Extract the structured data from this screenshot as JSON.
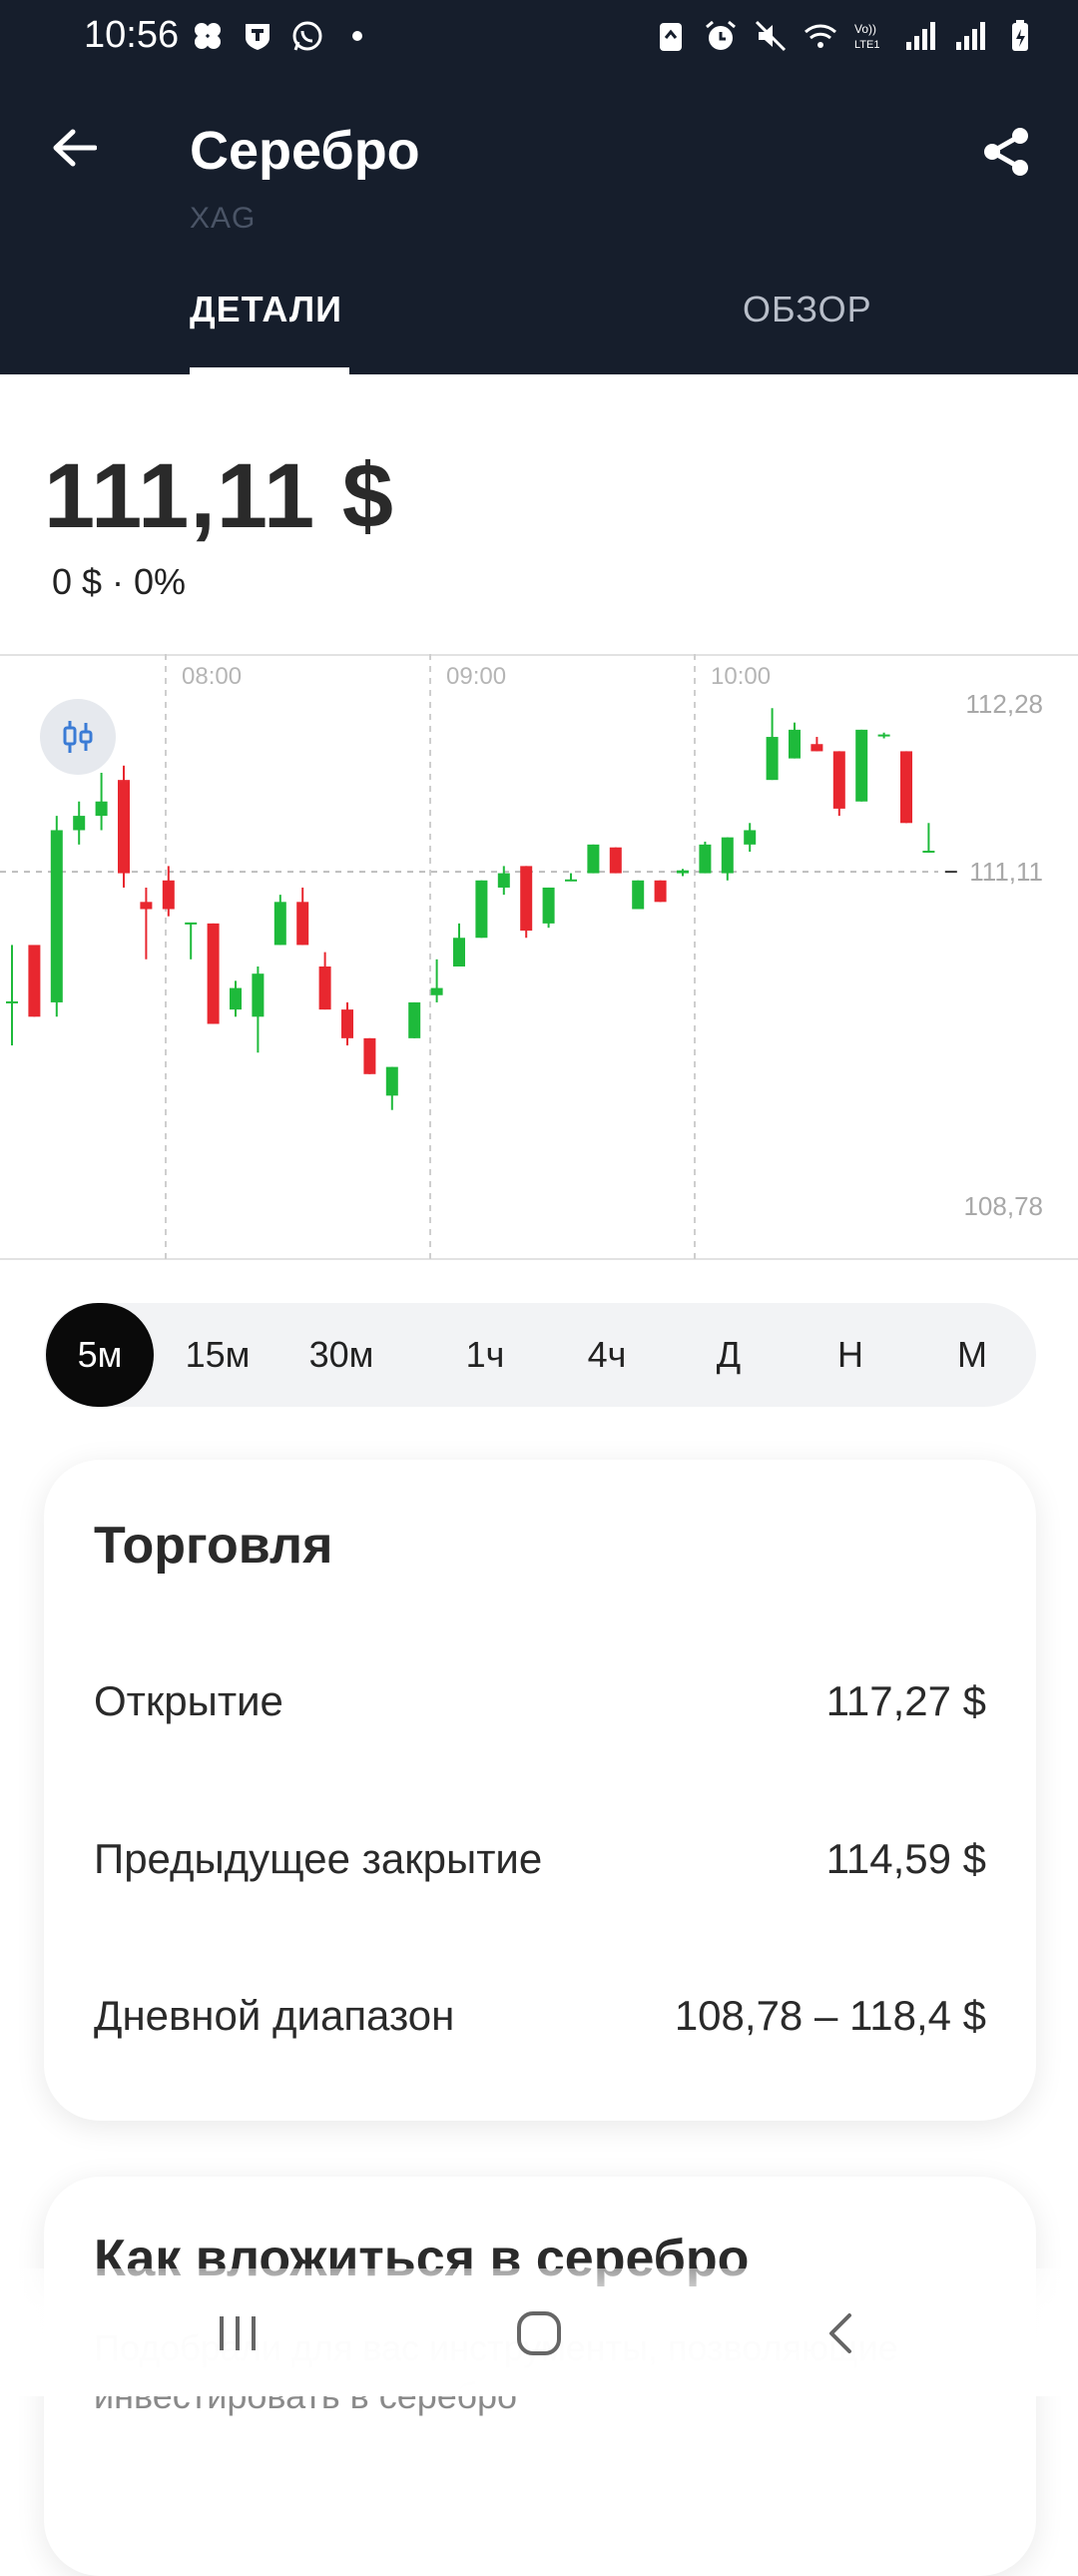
{
  "status_bar": {
    "time": "10:56",
    "icons": [
      "apps-icon",
      "shield-icon",
      "whatsapp-icon",
      "dot-icon",
      "recycle-icon",
      "alarm-icon",
      "mute-icon",
      "wifi-icon",
      "volte-icon",
      "signal-icon",
      "signal-icon",
      "battery-icon"
    ]
  },
  "header": {
    "title": "Серебро",
    "ticker": "XAG",
    "back_icon": "arrow-left-icon",
    "share_icon": "share-icon"
  },
  "tabs": [
    {
      "label": "ДЕТАЛИ",
      "active": true
    },
    {
      "label": "ОБЗОР",
      "active": false
    }
  ],
  "price": {
    "value": "111,11 $",
    "change": "0 $ · 0%"
  },
  "chart_data": {
    "type": "candlestick",
    "time_labels": [
      "08:00",
      "09:00",
      "10:00"
    ],
    "y_labels": [
      "112,28",
      "111,11",
      "108,78"
    ],
    "ylim": [
      108.78,
      112.28
    ],
    "current_value": 111.11,
    "colors": {
      "up": "#1eba3b",
      "down": "#e8272f",
      "grid": "#cfcfcf"
    },
    "candles": [
      {
        "o": 110.2,
        "c": 110.2,
        "h": 110.6,
        "l": 109.9
      },
      {
        "o": 110.6,
        "c": 110.1,
        "h": 110.2,
        "l": 110.4
      },
      {
        "o": 110.2,
        "c": 111.4,
        "h": 111.5,
        "l": 110.1
      },
      {
        "o": 111.4,
        "c": 111.5,
        "h": 111.6,
        "l": 111.3
      },
      {
        "o": 111.5,
        "c": 111.6,
        "h": 111.8,
        "l": 111.4
      },
      {
        "o": 111.75,
        "c": 111.1,
        "h": 111.85,
        "l": 111.0
      },
      {
        "o": 110.9,
        "c": 110.85,
        "h": 111.0,
        "l": 110.5
      },
      {
        "o": 111.05,
        "c": 110.85,
        "h": 111.15,
        "l": 110.8
      },
      {
        "o": 110.75,
        "c": 110.75,
        "h": 110.75,
        "l": 110.5
      },
      {
        "o": 110.75,
        "c": 110.05,
        "h": 110.75,
        "l": 110.05
      },
      {
        "o": 110.15,
        "c": 110.3,
        "h": 110.35,
        "l": 110.1
      },
      {
        "o": 110.1,
        "c": 110.4,
        "h": 110.45,
        "l": 109.85
      },
      {
        "o": 110.6,
        "c": 110.9,
        "h": 110.95,
        "l": 110.6
      },
      {
        "o": 110.9,
        "c": 110.6,
        "h": 111.0,
        "l": 110.6
      },
      {
        "o": 110.45,
        "c": 110.15,
        "h": 110.55,
        "l": 110.15
      },
      {
        "o": 110.15,
        "c": 109.95,
        "h": 110.2,
        "l": 109.9
      },
      {
        "o": 109.95,
        "c": 109.7,
        "h": 109.95,
        "l": 109.7
      },
      {
        "o": 109.55,
        "c": 109.75,
        "h": 109.75,
        "l": 109.45
      },
      {
        "o": 109.95,
        "c": 110.2,
        "h": 110.2,
        "l": 109.95
      },
      {
        "o": 110.25,
        "c": 110.3,
        "h": 110.5,
        "l": 110.2
      },
      {
        "o": 110.45,
        "c": 110.65,
        "h": 110.75,
        "l": 110.45
      },
      {
        "o": 110.65,
        "c": 111.05,
        "h": 111.05,
        "l": 110.65
      },
      {
        "o": 111.0,
        "c": 111.1,
        "h": 111.15,
        "l": 110.95
      },
      {
        "o": 111.15,
        "c": 110.7,
        "h": 111.15,
        "l": 110.65
      },
      {
        "o": 110.75,
        "c": 111.0,
        "h": 111.0,
        "l": 110.72
      },
      {
        "o": 111.05,
        "c": 111.05,
        "h": 111.1,
        "l": 111.05
      },
      {
        "o": 111.1,
        "c": 111.3,
        "h": 111.3,
        "l": 111.1
      },
      {
        "o": 111.28,
        "c": 111.1,
        "h": 111.28,
        "l": 111.1
      },
      {
        "o": 110.85,
        "c": 111.05,
        "h": 111.05,
        "l": 110.85
      },
      {
        "o": 111.05,
        "c": 110.9,
        "h": 111.05,
        "l": 110.9
      },
      {
        "o": 111.1,
        "c": 111.12,
        "h": 111.13,
        "l": 111.08
      },
      {
        "o": 111.1,
        "c": 111.3,
        "h": 111.32,
        "l": 111.1
      },
      {
        "o": 111.1,
        "c": 111.35,
        "h": 111.35,
        "l": 111.05
      },
      {
        "o": 111.3,
        "c": 111.4,
        "h": 111.45,
        "l": 111.25
      },
      {
        "o": 111.75,
        "c": 112.05,
        "h": 112.25,
        "l": 111.75
      },
      {
        "o": 111.9,
        "c": 112.1,
        "h": 112.15,
        "l": 111.9
      },
      {
        "o": 112.0,
        "c": 111.95,
        "h": 112.05,
        "l": 111.95
      },
      {
        "o": 111.95,
        "c": 111.55,
        "h": 111.95,
        "l": 111.5
      },
      {
        "o": 111.6,
        "c": 112.1,
        "h": 112.1,
        "l": 111.6
      },
      {
        "o": 112.06,
        "c": 112.06,
        "h": 112.08,
        "l": 112.04
      },
      {
        "o": 111.95,
        "c": 111.45,
        "h": 111.95,
        "l": 111.45
      },
      {
        "o": 111.25,
        "c": 111.25,
        "h": 111.45,
        "l": 111.25
      },
      {
        "o": 111.11,
        "c": 111.11,
        "h": 111.11,
        "l": 111.11
      }
    ]
  },
  "timeframes": [
    {
      "label": "5м",
      "active": true
    },
    {
      "label": "15м",
      "active": false
    },
    {
      "label": "30м",
      "active": false
    },
    {
      "label": "1ч",
      "active": false
    },
    {
      "label": "4ч",
      "active": false
    },
    {
      "label": "Д",
      "active": false
    },
    {
      "label": "Н",
      "active": false
    },
    {
      "label": "М",
      "active": false
    }
  ],
  "trading": {
    "title": "Торговля",
    "rows": [
      {
        "label": "Открытие",
        "value": "117,27 $"
      },
      {
        "label": "Предыдущее закрытие",
        "value": "114,59 $"
      },
      {
        "label": "Дневной диапазон",
        "value": "108,78 – 118,4 $"
      }
    ]
  },
  "invest": {
    "title": "Как вложиться в серебро",
    "subtitle": "Подобрали для вас инструменты, позволяющие инвестировать в серебро"
  },
  "nav": {
    "recent": "recent-apps-icon",
    "home": "home-icon",
    "back": "back-icon"
  }
}
